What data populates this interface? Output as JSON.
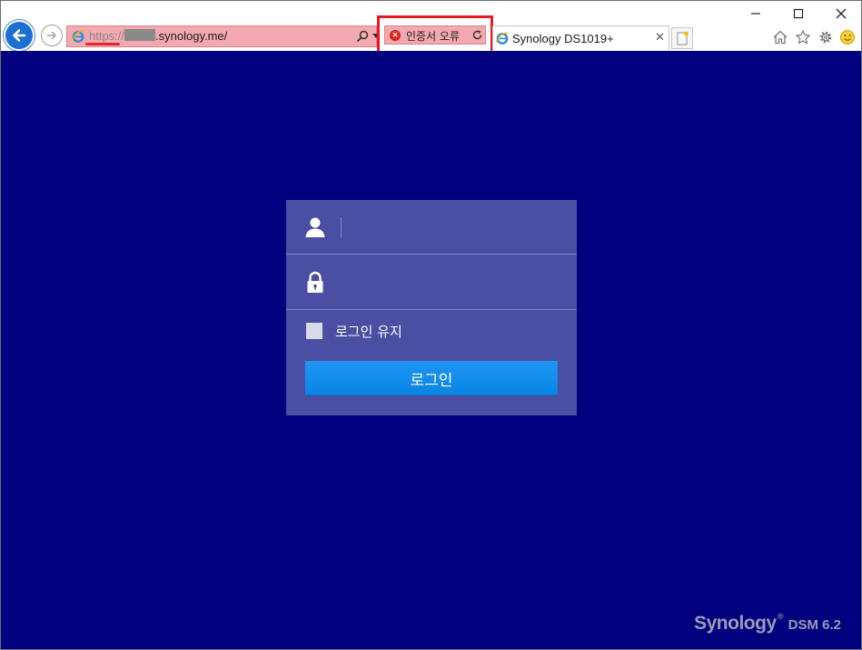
{
  "browser": {
    "url": {
      "scheme": "https://",
      "host": ".synology.me/"
    },
    "certificate_error_label": "인증서 오류",
    "tab": {
      "title": "Synology DS1019+",
      "close_glyph": "✕"
    },
    "icons": {
      "back": "back-arrow-icon",
      "forward": "forward-arrow-icon",
      "site": "internet-explorer-icon",
      "search": "search-icon",
      "refresh": "refresh-icon",
      "new_tab": "new-tab-icon",
      "home": "home-icon",
      "favorites": "star-icon",
      "tools": "gear-icon",
      "feedback": "smiley-icon"
    }
  },
  "login": {
    "username_placeholder": "",
    "password_placeholder": "",
    "remember_label": "로그인 유지",
    "remember_checked": false,
    "submit_label": "로그인"
  },
  "branding": {
    "vendor": "Synology",
    "trademark": "®",
    "product": "DSM 6.2"
  },
  "colors": {
    "page_background": "#01007e",
    "card_background": "#4b4fa4",
    "button": "#0a84e4",
    "address_bar_error": "#f4a9b0",
    "highlight_frame": "#e21b24"
  }
}
